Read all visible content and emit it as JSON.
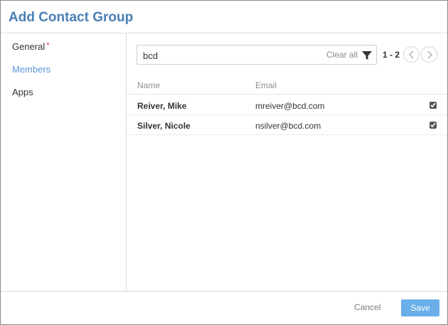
{
  "dialog": {
    "title": "Add Contact Group"
  },
  "sidebar": {
    "items": [
      {
        "label": "General",
        "required_marker": "*"
      },
      {
        "label": "Members"
      },
      {
        "label": "Apps"
      }
    ]
  },
  "search": {
    "value": "bcd",
    "clear_label": "Clear all",
    "filter_icon": "filter-icon"
  },
  "pager": {
    "range": "1 - 2",
    "prev_icon": "chevron-left-icon",
    "next_icon": "chevron-right-icon"
  },
  "table": {
    "headers": {
      "name": "Name",
      "email": "Email"
    },
    "rows": [
      {
        "name": "Reiver, Mike",
        "email": "mreiver@bcd.com",
        "checked": true
      },
      {
        "name": "Silver, Nicole",
        "email": "nsilver@bcd.com",
        "checked": true
      }
    ]
  },
  "footer": {
    "cancel_label": "Cancel",
    "save_label": "Save"
  },
  "colors": {
    "accent": "#4a7fb5",
    "active_nav": "#5a95d6",
    "save_button": "#6aaeea",
    "required": "#d23a3a"
  }
}
